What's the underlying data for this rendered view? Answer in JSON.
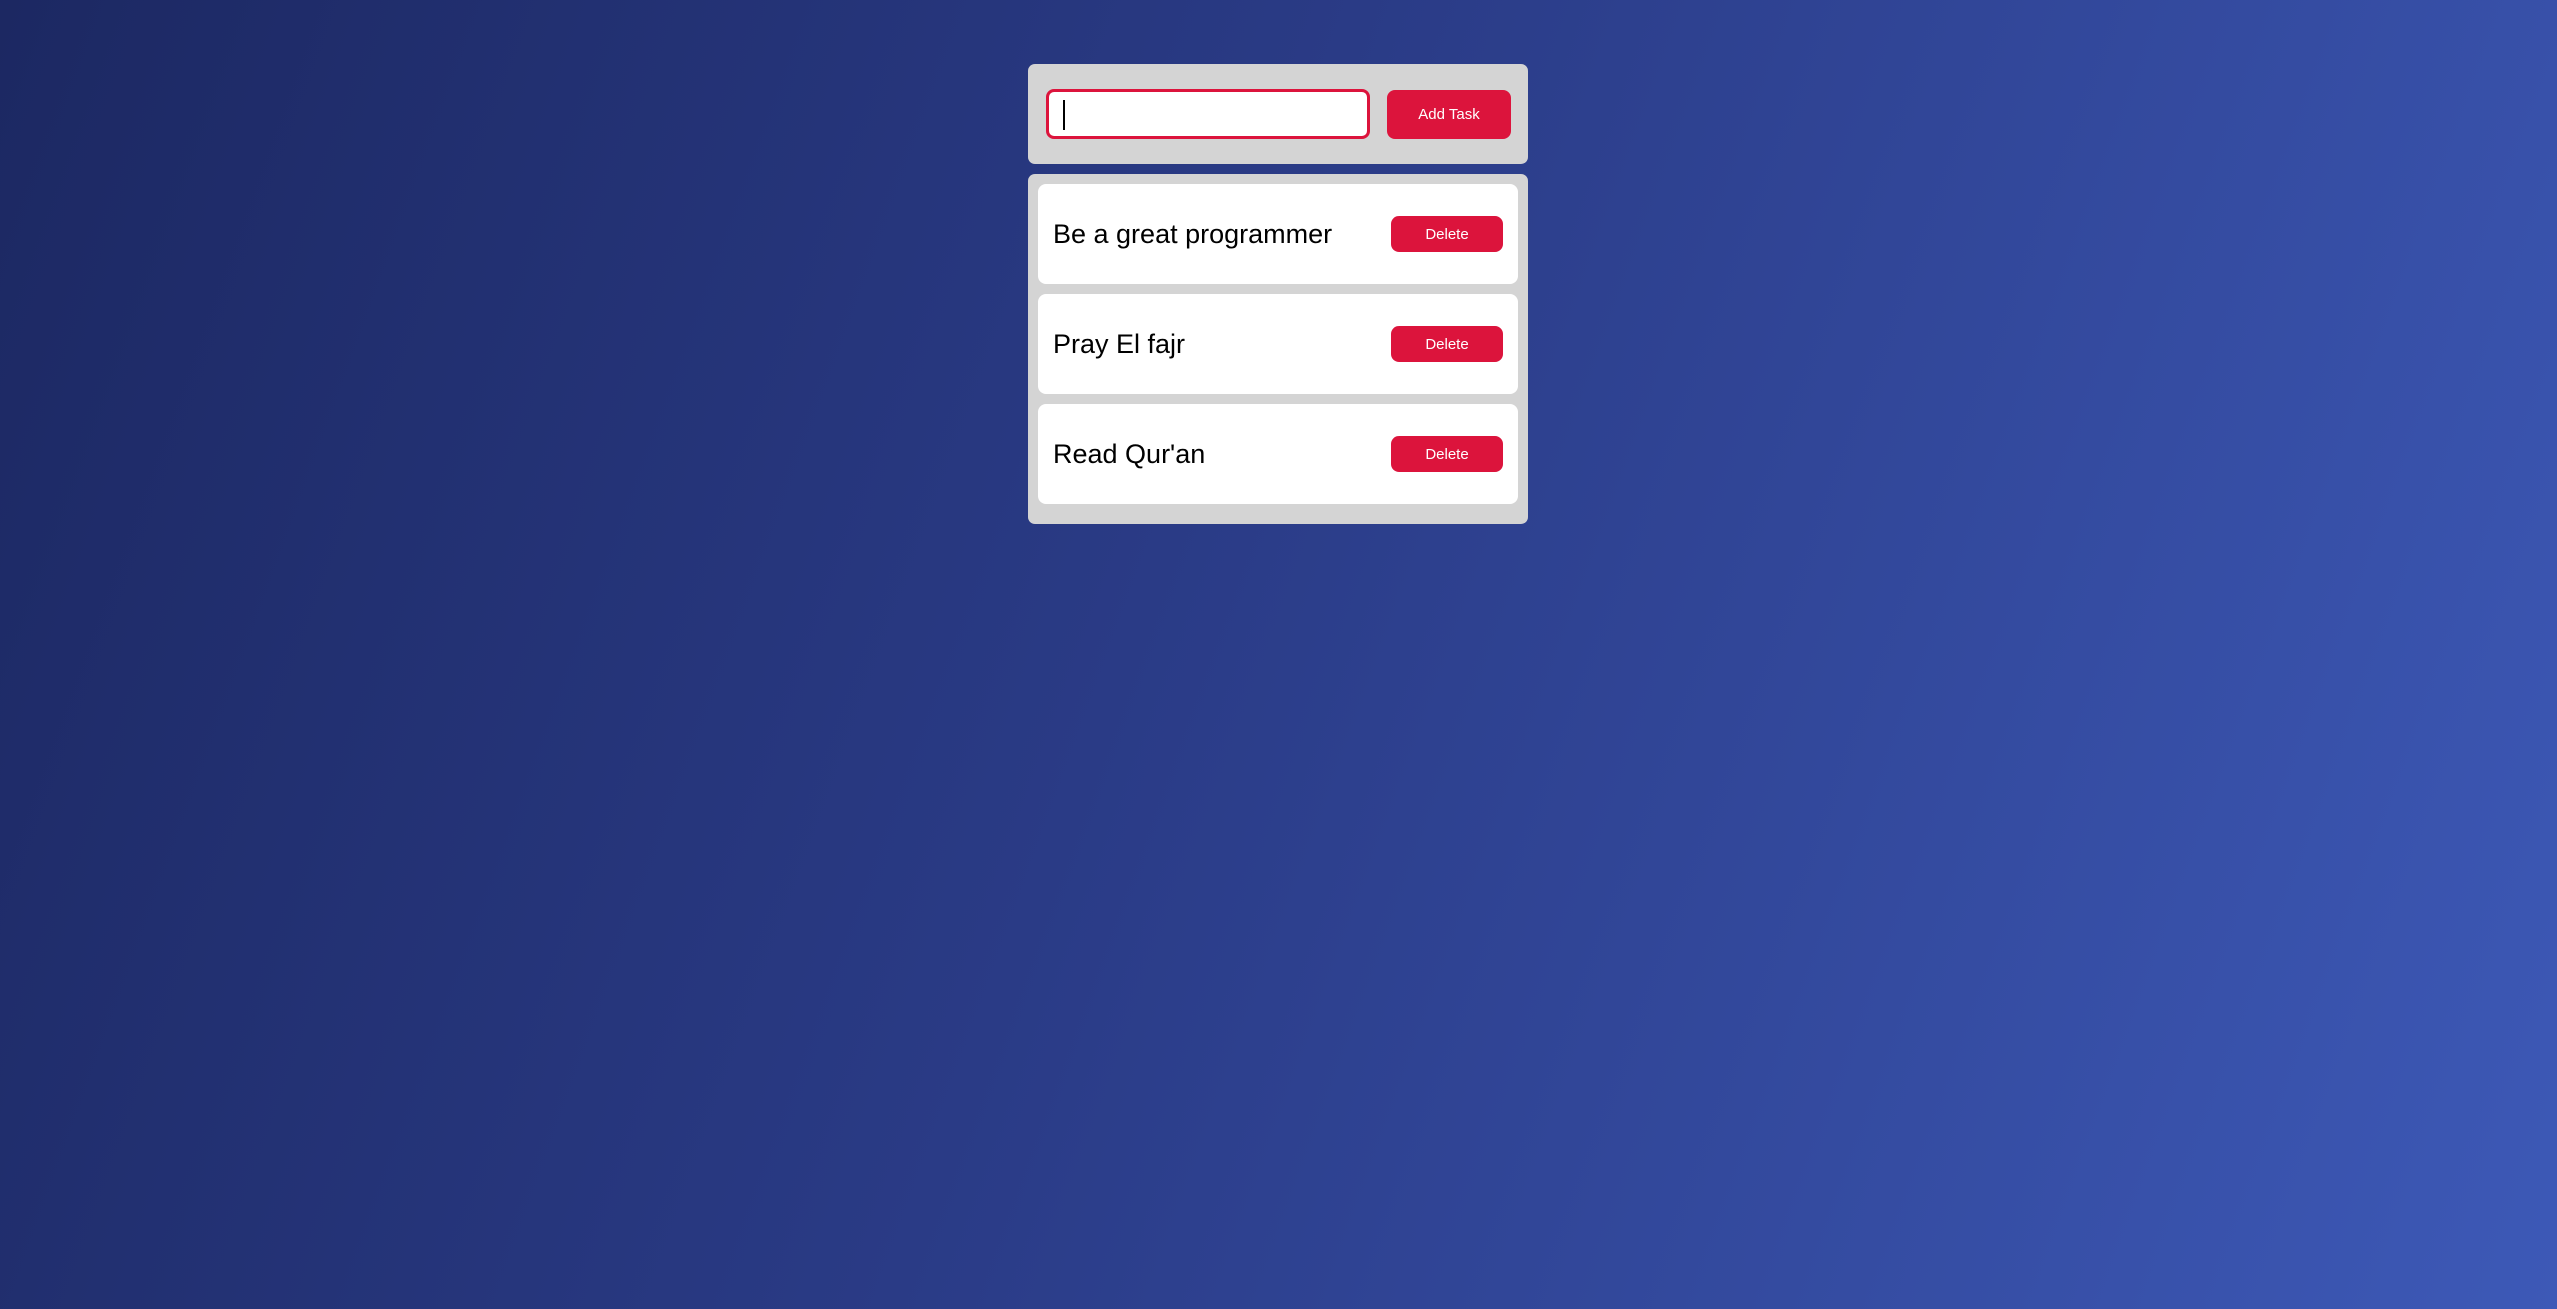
{
  "form": {
    "input_value": "",
    "input_placeholder": "",
    "add_label": "Add Task"
  },
  "tasks": [
    {
      "text": "Be a great programmer",
      "delete_label": "Delete"
    },
    {
      "text": "Pray El fajr",
      "delete_label": "Delete"
    },
    {
      "text": "Read Qur'an",
      "delete_label": "Delete"
    }
  ],
  "colors": {
    "accent": "#dc143c",
    "card_background": "#d4d4d4",
    "item_background": "#ffffff",
    "page_gradient_start": "#1c2862",
    "page_gradient_end": "#3d59b7"
  }
}
